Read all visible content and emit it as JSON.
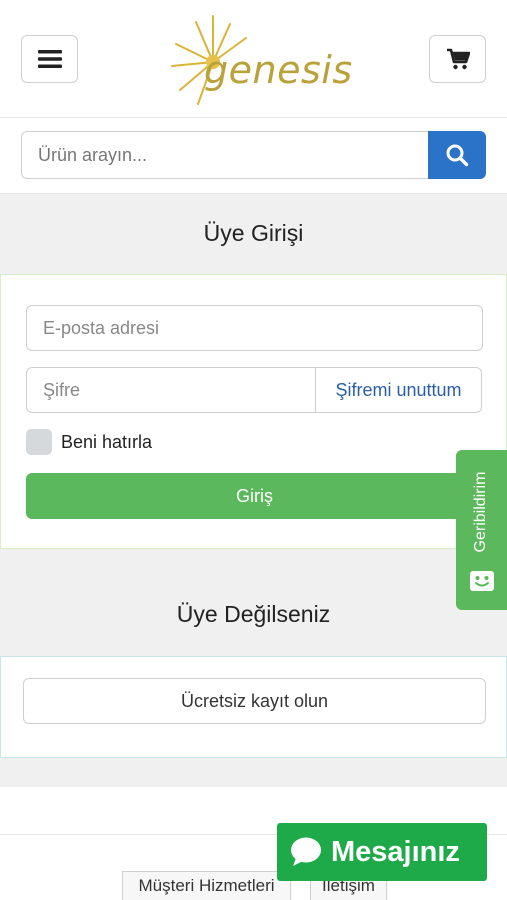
{
  "header": {
    "menu_icon": "hamburger-menu-icon",
    "logo_text": "genesis",
    "cart_icon": "shopping-cart-icon"
  },
  "search": {
    "placeholder": "Ürün arayın...",
    "button_icon": "search-icon"
  },
  "login": {
    "title": "Üye Girişi",
    "email_placeholder": "E-posta adresi",
    "password_placeholder": "Şifre",
    "forgot_label": "Şifremi unuttum",
    "remember_label": "Beni hatırla",
    "submit_label": "Giriş"
  },
  "register": {
    "title": "Üye Değilseniz",
    "button_label": "Ücretsiz kayıt olun"
  },
  "footer": {
    "links": [
      "Müşteri Hizmetleri",
      "İletişim"
    ]
  },
  "feedback": {
    "label": "Geribildirim",
    "icon": "smiley-face-icon"
  },
  "chat": {
    "label": "Mesajınız",
    "icon": "chat-bubble-icon"
  },
  "colors": {
    "primary_blue": "#2a73c9",
    "success_green": "#5cb85c",
    "chat_green": "#1faa4a",
    "logo_gold": "#b9a23a"
  }
}
